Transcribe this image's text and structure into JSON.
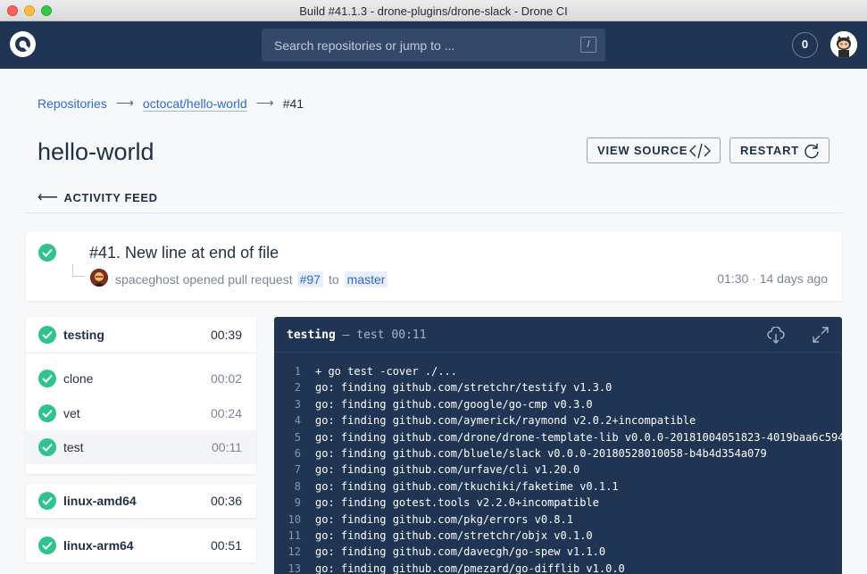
{
  "window": {
    "title": "Build #41.1.3 - drone-plugins/drone-slack - Drone CI"
  },
  "header": {
    "search_placeholder": "Search repositories or jump to ...",
    "search_shortcut": "/",
    "notification_count": "0"
  },
  "breadcrumb": {
    "root": "Repositories",
    "repo": "octocat/hello-world",
    "build": "#41"
  },
  "page": {
    "title": "hello-world",
    "view_source": "VIEW SOURCE",
    "restart": "RESTART",
    "activity_feed": "ACTIVITY FEED"
  },
  "build": {
    "title": "#41. New line at end of file",
    "author": "spaceghost",
    "action": "opened pull request",
    "pr": "#97",
    "to": "to",
    "branch": "master",
    "time": "01:30 · 14 days ago"
  },
  "stages": [
    {
      "name": "testing",
      "duration": "00:39",
      "steps": [
        {
          "name": "clone",
          "duration": "00:02"
        },
        {
          "name": "vet",
          "duration": "00:24"
        },
        {
          "name": "test",
          "duration": "00:11"
        }
      ]
    },
    {
      "name": "linux-amd64",
      "duration": "00:36"
    },
    {
      "name": "linux-arm64",
      "duration": "00:51"
    }
  ],
  "log": {
    "stage": "testing",
    "separator": "—",
    "step": "test",
    "duration": "00:11",
    "lines": [
      "+ go test -cover ./...",
      "go: finding github.com/stretchr/testify v1.3.0",
      "go: finding github.com/google/go-cmp v0.3.0",
      "go: finding github.com/aymerick/raymond v2.0.2+incompatible",
      "go: finding github.com/drone/drone-template-lib v0.0.0-20181004051823-4019baa6c594",
      "go: finding github.com/bluele/slack v0.0.0-20180528010058-b4b4d354a079",
      "go: finding github.com/urfave/cli v1.20.0",
      "go: finding github.com/tkuchiki/faketime v0.1.1",
      "go: finding gotest.tools v2.2.0+incompatible",
      "go: finding github.com/pkg/errors v0.8.1",
      "go: finding github.com/stretchr/objx v0.1.0",
      "go: finding github.com/davecgh/go-spew v1.1.0",
      "go: finding github.com/pmezard/go-difflib v1.0.0"
    ]
  },
  "colors": {
    "header_bg": "#1f3553",
    "success": "#2fc48d",
    "link": "#2f6bc9"
  }
}
